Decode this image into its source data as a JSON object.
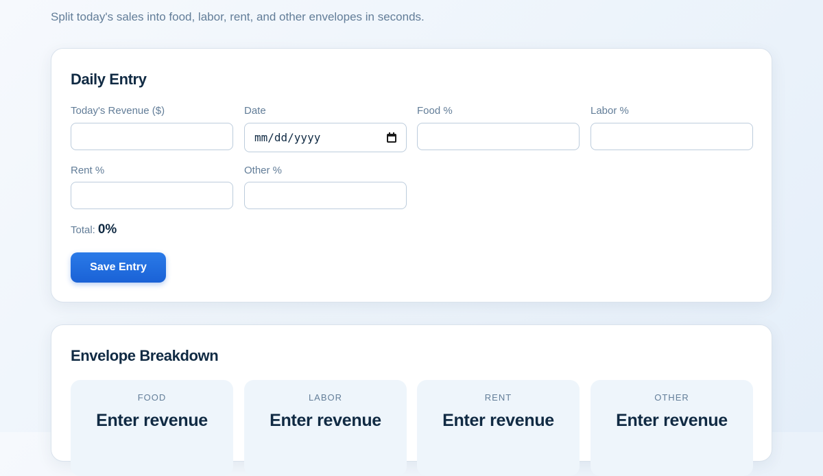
{
  "header": {
    "subtitle": "Split today's sales into food, labor, rent, and other envelopes in seconds."
  },
  "entry": {
    "title": "Daily Entry",
    "fields": {
      "revenue": {
        "label": "Today's Revenue ($)",
        "value": ""
      },
      "date": {
        "label": "Date",
        "placeholder": "mm/dd/yyyy"
      },
      "food": {
        "label": "Food %",
        "value": ""
      },
      "labor": {
        "label": "Labor %",
        "value": ""
      },
      "rent": {
        "label": "Rent %",
        "value": ""
      },
      "other": {
        "label": "Other %",
        "value": ""
      }
    },
    "total_label": "Total:",
    "total_value": "0%",
    "save_label": "Save Entry"
  },
  "envelopes": {
    "title": "Envelope Breakdown",
    "items": [
      {
        "label": "FOOD",
        "value": "Enter revenue"
      },
      {
        "label": "LABOR",
        "value": "Enter revenue"
      },
      {
        "label": "RENT",
        "value": "Enter revenue"
      },
      {
        "label": "OTHER",
        "value": "Enter revenue"
      }
    ]
  },
  "icons": {
    "date_picker": "calendar-icon"
  },
  "colors": {
    "accent": "#1f6fe0",
    "text_primary": "#102a43",
    "text_muted": "#627d98",
    "tile_bg": "#eef5fb"
  }
}
